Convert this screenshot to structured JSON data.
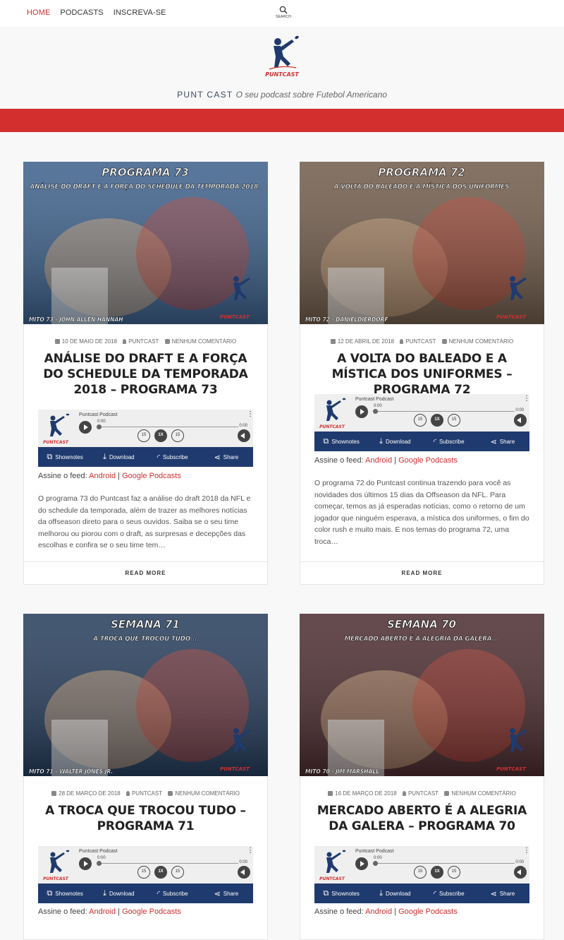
{
  "nav": {
    "items": [
      {
        "label": "HOME",
        "active": true
      },
      {
        "label": "PODCASTS",
        "active": false
      },
      {
        "label": "INSCREVA-SE",
        "active": false
      }
    ],
    "search_label": "SEARCH"
  },
  "header": {
    "logo_text": "PUNTCAST",
    "site_name": "PUNT CAST",
    "description": "O seu podcast sobre Futebol Americano"
  },
  "colors": {
    "accent": "#d32f2f",
    "player_bar": "#1f3a6e",
    "link": "#d32f2f"
  },
  "posts": [
    {
      "image": {
        "heading": "PROGRAMA 73",
        "subheading": "ANÁLISE DO DRAFT E A FORÇA DO SCHEDULE DA TEMPORADA 2018.",
        "caption": "MITO 73 - JOHN ALLEN HANNAH",
        "bg": "#3b5f8a"
      },
      "date": "10 DE MAIO DE 2018",
      "author": "PUNTCAST",
      "comments": "NENHUM COMENTÁRIO",
      "title": "ANÁLISE DO DRAFT E A FORÇA DO SCHEDULE DA TEMPORADA 2018 – PROGRAMA 73",
      "feed_prefix": "Assine o feed:",
      "feed_android": "Android",
      "feed_google": "Google Podcasts",
      "excerpt": "O programa 73 do Puntcast faz a análise do draft 2018 da NFL e do schedule da temporada, além de trazer as melhores notícias da offseason direto para o seus ouvidos. Saiba se o seu time melhorou ou piorou com o draft, as surpresas e decepções das escolhas e confira se o seu time tem…",
      "read_more": "READ MORE"
    },
    {
      "image": {
        "heading": "PROGRAMA 72",
        "subheading": "A VOLTA DO BALEADO E A MÍSTICA DOS UNIFORMES",
        "caption": "MITO 72 - DANIELDIERDORF",
        "bg": "#6f5a49"
      },
      "date": "12 DE ABRIL DE 2018",
      "author": "PUNTCAST",
      "comments": "NENHUM COMENTÁRIO",
      "title": "A VOLTA DO BALEADO E A MÍSTICA DOS UNIFORMES – PROGRAMA 72",
      "feed_prefix": "Assine o feed:",
      "feed_android": "Android",
      "feed_google": "Google Podcasts",
      "excerpt": "O programa 72 do Puntcast continua trazendo para você as novidades dos últimos 15 dias da Offseason da NFL. Para começar, temos as já esperadas notícias, como o retorno de um jogador que ninguém esperava, a mística dos uniformes, o fim do color rush e muito mais. E nos temas do programa 72, uma troca…",
      "read_more": "READ MORE"
    },
    {
      "image": {
        "heading": "SEMANA 71",
        "subheading": "A TROCA QUE TROCOU TUDO...",
        "caption": "MITO 71 - WALTER JONES JR.",
        "bg": "#243b5a"
      },
      "date": "28 DE MARÇO DE 2018",
      "author": "PUNTCAST",
      "comments": "NENHUM COMENTÁRIO",
      "title": "A TROCA QUE TROCOU TUDO – PROGRAMA 71",
      "feed_prefix": "Assine o feed:",
      "feed_android": "Android",
      "feed_google": "Google Podcasts"
    },
    {
      "image": {
        "heading": "SEMANA 70",
        "subheading": "MERCADO ABERTO É A ALEGRIA DA GALERA...",
        "caption": "MITO 70 - JIM MARSHALL",
        "bg": "#4a2a2e"
      },
      "date": "16 DE MARÇO DE 2018",
      "author": "PUNTCAST",
      "comments": "NENHUM COMENTÁRIO",
      "title": "MERCADO ABERTO É A ALEGRIA DA GALERA – PROGRAMA 70",
      "feed_prefix": "Assine o feed:",
      "feed_android": "Android",
      "feed_google": "Google Podcasts"
    }
  ],
  "player": {
    "name": "Puntcast Podcast",
    "time_start": "0:00",
    "time_end": "0:00",
    "skip_back": "15",
    "speed": "1X",
    "skip_fwd": "15",
    "buttons": [
      {
        "label": "Shownotes",
        "icon": "external-link-icon"
      },
      {
        "label": "Download",
        "icon": "download-icon"
      },
      {
        "label": "Subscribe",
        "icon": "rss-icon"
      },
      {
        "label": "Share",
        "icon": "share-icon"
      }
    ]
  }
}
